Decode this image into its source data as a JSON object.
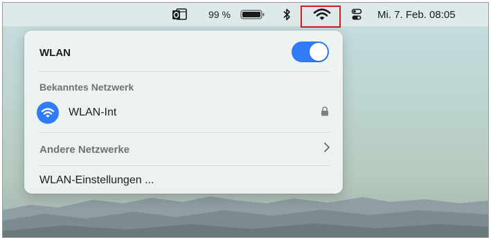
{
  "menubar": {
    "battery_percent": "99 %",
    "battery_level": 0.99,
    "datetime": "Mi. 7. Feb. 08:05",
    "icons": [
      "outlook-icon",
      "battery-icon",
      "bluetooth-icon",
      "wifi-icon",
      "control-center-icon"
    ]
  },
  "wlan_menu": {
    "title": "WLAN",
    "toggle_on": true,
    "known_section": "Bekanntes Netzwerk",
    "network_name": "WLAN-Int",
    "other_networks": "Andere Netzwerke",
    "settings": "WLAN-Einstellungen ..."
  },
  "colors": {
    "accent": "#2f7cf6",
    "highlight": "#d11b1b"
  }
}
